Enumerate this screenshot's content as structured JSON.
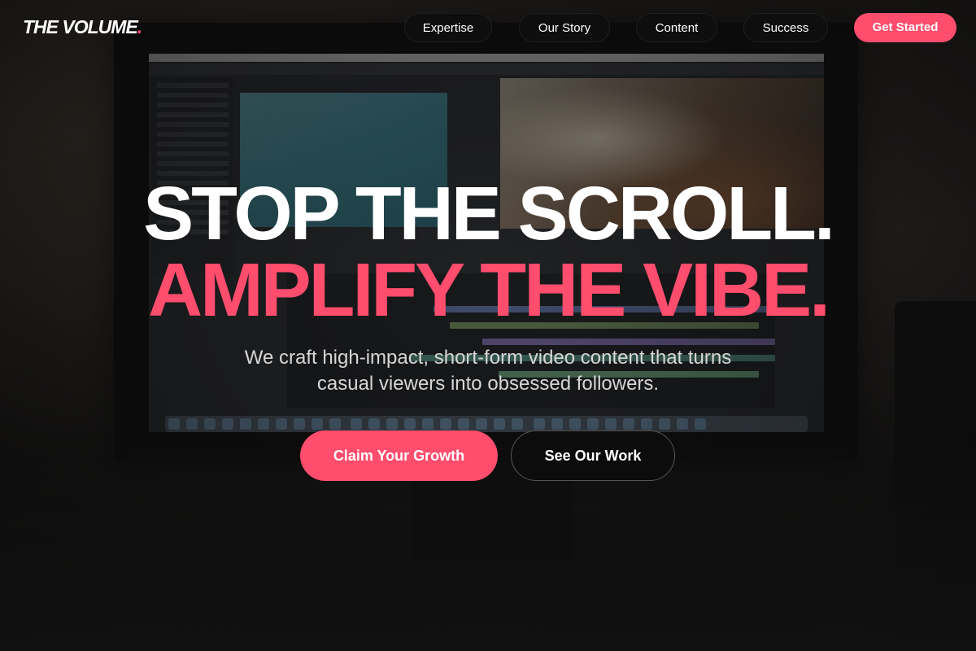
{
  "header": {
    "logo_text": "THE VOLUME",
    "logo_dot": ".",
    "nav": [
      {
        "label": "Expertise"
      },
      {
        "label": "Our Story"
      },
      {
        "label": "Content"
      },
      {
        "label": "Success"
      }
    ],
    "cta_label": "Get Started"
  },
  "hero": {
    "headline_line1": "STOP THE SCROLL.",
    "headline_line2": "AMPLIFY THE VIBE.",
    "subtitle_line1": "We craft high-impact, short-form video content that turns",
    "subtitle_line2": "casual viewers into obsessed followers.",
    "primary_button": "Claim Your Growth",
    "secondary_button": "See Our Work"
  },
  "colors": {
    "accent": "#ff4d6d",
    "background": "#161616",
    "text": "#ffffff",
    "muted_text": "#d6d6d6"
  }
}
